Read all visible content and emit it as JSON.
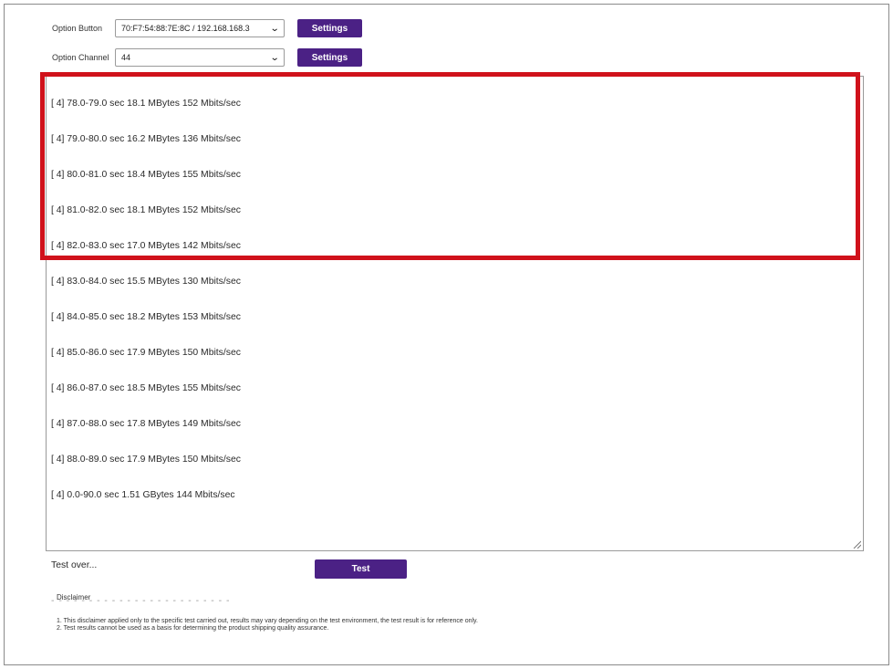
{
  "options": [
    {
      "label": "Option Button",
      "value": "70:F7:54:88:7E:8C / 192.168.168.3",
      "button": "Settings"
    },
    {
      "label": "Option Channel",
      "value": "44",
      "button": "Settings"
    }
  ],
  "log_lines": [
    "[ 4] 78.0-79.0 sec 18.1 MBytes 152 Mbits/sec",
    "[ 4] 79.0-80.0 sec 16.2 MBytes 136 Mbits/sec",
    "[ 4] 80.0-81.0 sec 18.4 MBytes 155 Mbits/sec",
    "[ 4] 81.0-82.0 sec 18.1 MBytes 152 Mbits/sec",
    "[ 4] 82.0-83.0 sec 17.0 MBytes 142 Mbits/sec",
    "[ 4] 83.0-84.0 sec 15.5 MBytes 130 Mbits/sec",
    "[ 4] 84.0-85.0 sec 18.2 MBytes 153 Mbits/sec",
    "[ 4] 85.0-86.0 sec 17.9 MBytes 150 Mbits/sec",
    "[ 4] 86.0-87.0 sec 18.5 MBytes 155 Mbits/sec",
    "[ 4] 87.0-88.0 sec 17.8 MBytes 149 Mbits/sec",
    "[ 4] 88.0-89.0 sec 17.9 MBytes 150 Mbits/sec",
    "[ 4] 0.0-90.0 sec 1.51 GBytes 144 Mbits/sec"
  ],
  "status_text": "Test over...",
  "divider_text": "- - - - - - - - - - - - - - - - - - - - - - - -",
  "test_button": "Test",
  "disclaimer": {
    "title": "Disclaimer",
    "lines": [
      "1. This disclaimer applied only to the specific test carried out, results may vary depending on the test environment, the test result is for reference only.",
      "2. Test results cannot be used as a basis for determining the product shipping quality assurance."
    ]
  },
  "colors": {
    "accent": "#4b2185",
    "highlight": "#d0121b"
  }
}
